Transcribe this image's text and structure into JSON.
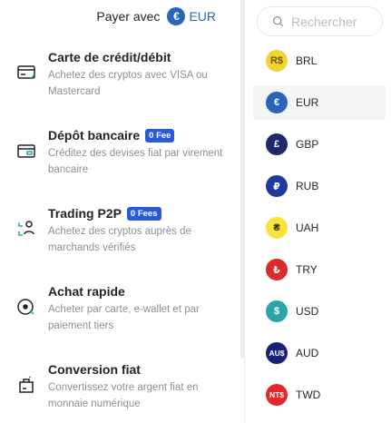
{
  "header": {
    "pay_with_label": "Payer avec",
    "currency_symbol": "€",
    "currency_code": "EUR"
  },
  "options": [
    {
      "title": "Carte de crédit/débit",
      "badge": "",
      "description": "Achetez des cryptos avec VISA ou Mastercard",
      "icon": "credit-card-icon"
    },
    {
      "title": "Dépôt bancaire",
      "badge": "0 Fee",
      "description": "Créditez des devises fiat par virement bancaire",
      "icon": "bank-deposit-icon"
    },
    {
      "title": "Trading P2P",
      "badge": "0 Fees",
      "description": "Achetez des cryptos auprès de marchands vérifiés",
      "icon": "p2p-users-icon"
    },
    {
      "title": "Achat rapide",
      "badge": "",
      "description": "Acheter par carte, e-wallet et par paiement tiers",
      "icon": "quick-buy-icon"
    },
    {
      "title": "Conversion fiat",
      "badge": "",
      "description": "Convertissez votre argent fiat en monnaie numérique",
      "icon": "fiat-convert-icon"
    }
  ],
  "search": {
    "placeholder": "Rechercher"
  },
  "currencies": [
    {
      "code": "BRL",
      "symbol": "R$",
      "color": "#f0d437",
      "text_color": "#6b5a00"
    },
    {
      "code": "EUR",
      "symbol": "€",
      "color": "#2a66b8",
      "text_color": "#ffffff",
      "selected": true
    },
    {
      "code": "GBP",
      "symbol": "£",
      "color": "#1c2a6b",
      "text_color": "#ffffff"
    },
    {
      "code": "RUB",
      "symbol": "₽",
      "color": "#1e3a9e",
      "text_color": "#ffffff"
    },
    {
      "code": "UAH",
      "symbol": "₴",
      "color": "#f7e33b",
      "text_color": "#3a3300"
    },
    {
      "code": "TRY",
      "symbol": "₺",
      "color": "#d92b2b",
      "text_color": "#ffffff"
    },
    {
      "code": "USD",
      "symbol": "$",
      "color": "#2aa5a8",
      "text_color": "#ffffff"
    },
    {
      "code": "AUD",
      "symbol": "AU$",
      "color": "#17237a",
      "text_color": "#ffffff"
    },
    {
      "code": "TWD",
      "symbol": "NT$",
      "color": "#e5262b",
      "text_color": "#ffffff"
    }
  ]
}
